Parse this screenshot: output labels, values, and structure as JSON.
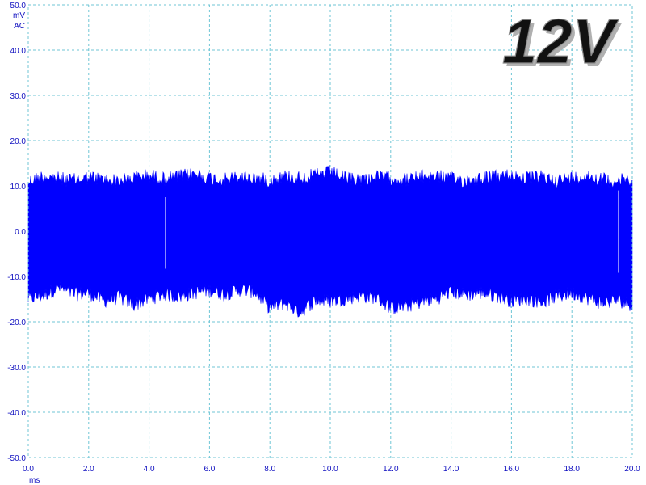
{
  "chart_data": {
    "type": "line",
    "title": "12V",
    "y_unit": "mV",
    "y_coupling": "AC",
    "xlabel": "ms",
    "xlim": [
      0,
      20
    ],
    "ylim": [
      -50,
      50
    ],
    "x_ticks": [
      "0.0",
      "2.0",
      "4.0",
      "6.0",
      "8.0",
      "10.0",
      "12.0",
      "14.0",
      "16.0",
      "18.0",
      "20.0"
    ],
    "y_ticks": [
      "50.0",
      "40.0",
      "30.0",
      "20.0",
      "10.0",
      "0.0",
      "-10.0",
      "-20.0",
      "-30.0",
      "-40.0",
      "-50.0"
    ],
    "grid": true,
    "series": [
      {
        "color": "#0000ff",
        "x": [
          0.0,
          0.5,
          1.0,
          1.5,
          2.0,
          2.5,
          3.0,
          3.5,
          4.0,
          4.5,
          5.0,
          5.5,
          6.0,
          6.5,
          7.0,
          7.5,
          8.0,
          8.5,
          9.0,
          9.5,
          10.0,
          10.5,
          11.0,
          11.5,
          12.0,
          12.5,
          13.0,
          13.5,
          14.0,
          14.5,
          15.0,
          15.5,
          16.0,
          16.5,
          17.0,
          17.5,
          18.0,
          18.5,
          19.0,
          19.5,
          20.0
        ],
        "y_max": [
          12.5,
          13.8,
          13.2,
          12.8,
          13.5,
          13.0,
          12.6,
          13.4,
          13.9,
          13.1,
          13.6,
          14.2,
          13.3,
          12.9,
          13.5,
          13.2,
          12.8,
          13.7,
          13.4,
          13.9,
          14.6,
          13.2,
          13.0,
          13.5,
          13.3,
          12.9,
          13.6,
          13.8,
          13.1,
          12.7,
          13.4,
          13.6,
          14.0,
          13.2,
          13.5,
          12.8,
          13.3,
          13.9,
          13.0,
          12.6,
          13.2
        ],
        "y_min": [
          -16.5,
          -15.8,
          -14.0,
          -15.5,
          -15.2,
          -17.0,
          -16.2,
          -17.8,
          -16.5,
          -15.5,
          -16.0,
          -15.2,
          -14.6,
          -15.5,
          -14.5,
          -15.0,
          -18.5,
          -17.5,
          -19.5,
          -16.8,
          -17.0,
          -16.5,
          -15.8,
          -16.2,
          -18.5,
          -18.2,
          -17.2,
          -16.5,
          -15.0,
          -15.6,
          -15.2,
          -15.8,
          -17.0,
          -16.5,
          -17.2,
          -16.0,
          -15.2,
          -16.3,
          -17.5,
          -16.8,
          -17.8
        ],
        "spikes": [
          {
            "x": 4.55,
            "y_min": -8.3,
            "y_max": 7.5
          },
          {
            "x": 19.55,
            "y_min": -9.2,
            "y_max": 9.0
          }
        ]
      }
    ]
  }
}
